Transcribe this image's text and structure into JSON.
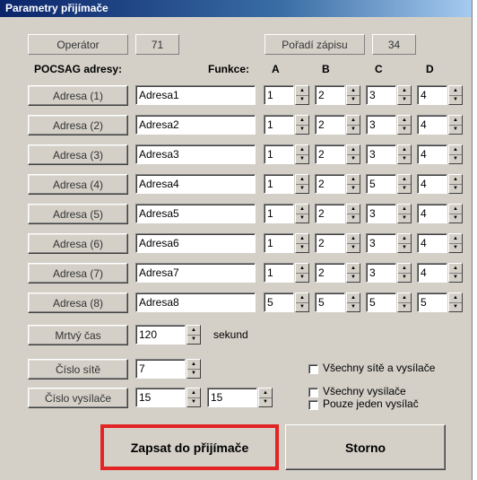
{
  "window": {
    "title": "Parametry přijímače"
  },
  "top": {
    "operator_label": "Operátor",
    "operator_value": "71",
    "order_label": "Pořadí zápisu",
    "order_value": "34"
  },
  "headers": {
    "pocsag": "POCSAG adresy:",
    "funkce": "Funkce:",
    "a": "A",
    "b": "B",
    "c": "C",
    "d": "D"
  },
  "addresses": [
    {
      "button": "Adresa (1)",
      "name": "Adresa1",
      "a": "1",
      "b": "2",
      "c": "3",
      "d": "4"
    },
    {
      "button": "Adresa (2)",
      "name": "Adresa2",
      "a": "1",
      "b": "2",
      "c": "3",
      "d": "4"
    },
    {
      "button": "Adresa (3)",
      "name": "Adresa3",
      "a": "1",
      "b": "2",
      "c": "3",
      "d": "4"
    },
    {
      "button": "Adresa (4)",
      "name": "Adresa4",
      "a": "1",
      "b": "2",
      "c": "5",
      "d": "4"
    },
    {
      "button": "Adresa (5)",
      "name": "Adresa5",
      "a": "1",
      "b": "2",
      "c": "3",
      "d": "4"
    },
    {
      "button": "Adresa (6)",
      "name": "Adresa6",
      "a": "1",
      "b": "2",
      "c": "3",
      "d": "4"
    },
    {
      "button": "Adresa (7)",
      "name": "Adresa7",
      "a": "1",
      "b": "2",
      "c": "3",
      "d": "4"
    },
    {
      "button": "Adresa (8)",
      "name": "Adresa8",
      "a": "5",
      "b": "5",
      "c": "5",
      "d": "5"
    }
  ],
  "dead_time": {
    "label": "Mrtvý čas",
    "value": "120",
    "unit": "sekund"
  },
  "network": {
    "label": "Číslo sítě",
    "value": "7"
  },
  "transmitter": {
    "label": "Číslo vysílače",
    "value1": "15",
    "value2": "15"
  },
  "checkboxes": {
    "all_networks": "Všechny sítě a vysílače",
    "all_transmitters": "Všechny vysílače",
    "single_transmitter": "Pouze jeden vysílač"
  },
  "actions": {
    "write": "Zapsat do přijímače",
    "cancel": "Storno"
  },
  "colors": {
    "highlight": "#e32424",
    "title_bar": "#0a246a"
  }
}
